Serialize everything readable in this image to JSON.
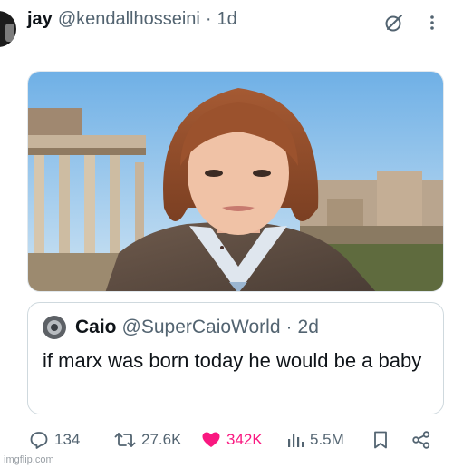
{
  "author": {
    "name": "jay",
    "handle": "@kendallhosseini",
    "separator": "·",
    "time": "1d"
  },
  "quoted": {
    "name": "Caio",
    "handle": "@SuperCaioWorld",
    "separator": "·",
    "time": "2d",
    "text": "if marx was born today he would be a baby"
  },
  "actions": {
    "replies": "134",
    "reposts": "27.6K",
    "likes": "342K",
    "views": "5.5M"
  },
  "watermark": "imgflip.com",
  "colors": {
    "like": "#f91880",
    "secondary_text": "#536471",
    "border": "#cfd9de"
  },
  "icons": [
    "grok-icon",
    "more-icon",
    "reply-icon",
    "repost-icon",
    "like-icon",
    "views-icon",
    "bookmark-icon",
    "share-icon"
  ]
}
